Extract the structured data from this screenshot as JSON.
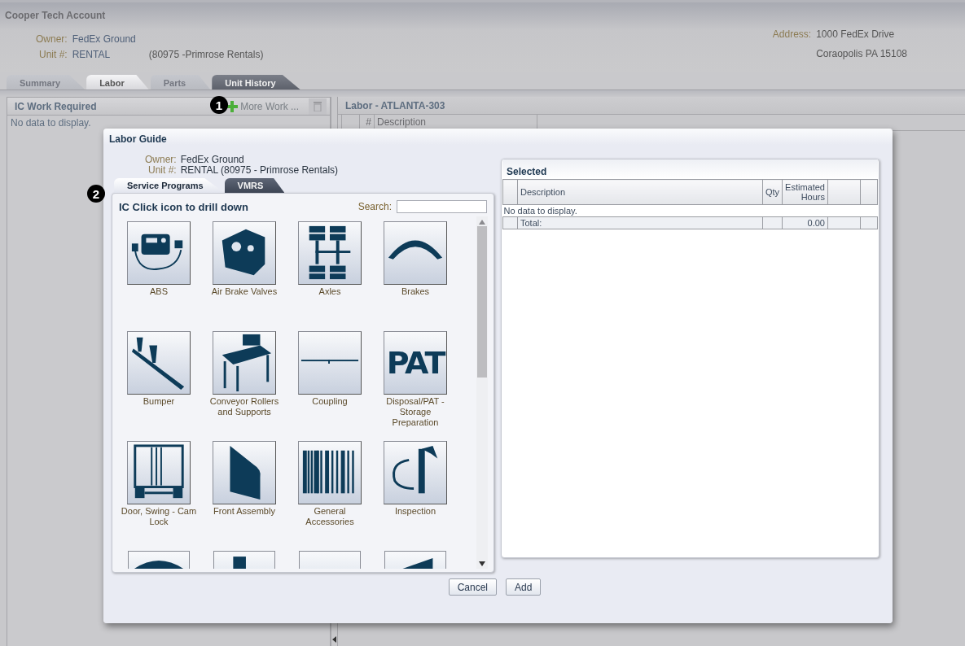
{
  "account": {
    "title": "Cooper Tech Account",
    "fields": [
      {
        "label": "Owner:",
        "value": "FedEx Ground"
      },
      {
        "label": "Unit #:",
        "value": "RENTAL",
        "extra": "(80975 -Primrose Rentals)"
      }
    ],
    "address": {
      "label": "Address:",
      "lines": [
        "1000 FedEx Drive",
        "Coraopolis PA 15108"
      ]
    }
  },
  "tabs": [
    {
      "label": "Summary",
      "selected": false,
      "disabled": true
    },
    {
      "label": "Labor",
      "selected": true,
      "disabled": false
    },
    {
      "label": "Parts",
      "selected": false,
      "disabled": true
    },
    {
      "label": "Unit History",
      "selected": false,
      "disabled": false
    }
  ],
  "work_panel": {
    "title": "IC Work Required",
    "callout": "1",
    "add_label": "More Work ...",
    "empty": "No data to display."
  },
  "labor_panel": {
    "title": "Labor - ATLANTA-303",
    "columns": [
      "#",
      "Description"
    ]
  },
  "dialog": {
    "title": "Labor Guide",
    "fields": [
      {
        "label": "Owner:",
        "value": "FedEx Ground"
      },
      {
        "label": "Unit #:",
        "value": "RENTAL (80975 - Primrose Rentals)"
      }
    ],
    "callout": "2",
    "tabs": [
      {
        "label": "Service Programs",
        "selected": true
      },
      {
        "label": "VMRS",
        "selected": false
      }
    ],
    "catalog": {
      "title": "IC Click icon to drill down",
      "search_label": "Search:",
      "items": [
        {
          "kind": "tile",
          "label": "ABS"
        },
        {
          "kind": "tile",
          "label": "Air Brake Valves"
        },
        {
          "kind": "tile",
          "label": "Axles"
        },
        {
          "kind": "tile",
          "label": "Brakes"
        },
        {
          "kind": "tile",
          "label": "Bumper"
        },
        {
          "kind": "tile",
          "label": "Conveyor Rollers and Supports"
        },
        {
          "kind": "tile",
          "label": "Coupling"
        },
        {
          "kind": "tile",
          "label": "Disposal/PAT - Storage Preparation",
          "icon_text": "PAT"
        },
        {
          "kind": "tile",
          "label": "Door, Swing - Cam Lock"
        },
        {
          "kind": "tile",
          "label": "Front Assembly"
        },
        {
          "kind": "tile",
          "label": "General Accessories"
        },
        {
          "kind": "tile",
          "label": "Inspection"
        },
        {
          "kind": "partial"
        },
        {
          "kind": "partial"
        },
        {
          "kind": "partial"
        },
        {
          "kind": "partial"
        }
      ]
    },
    "selected": {
      "title": "Selected",
      "columns": [
        "Description",
        "Qty",
        "Estimated Hours"
      ],
      "empty": "No data to display.",
      "total_label": "Total:",
      "total_hours": "0.00"
    },
    "buttons": [
      "Cancel",
      "Add"
    ]
  }
}
